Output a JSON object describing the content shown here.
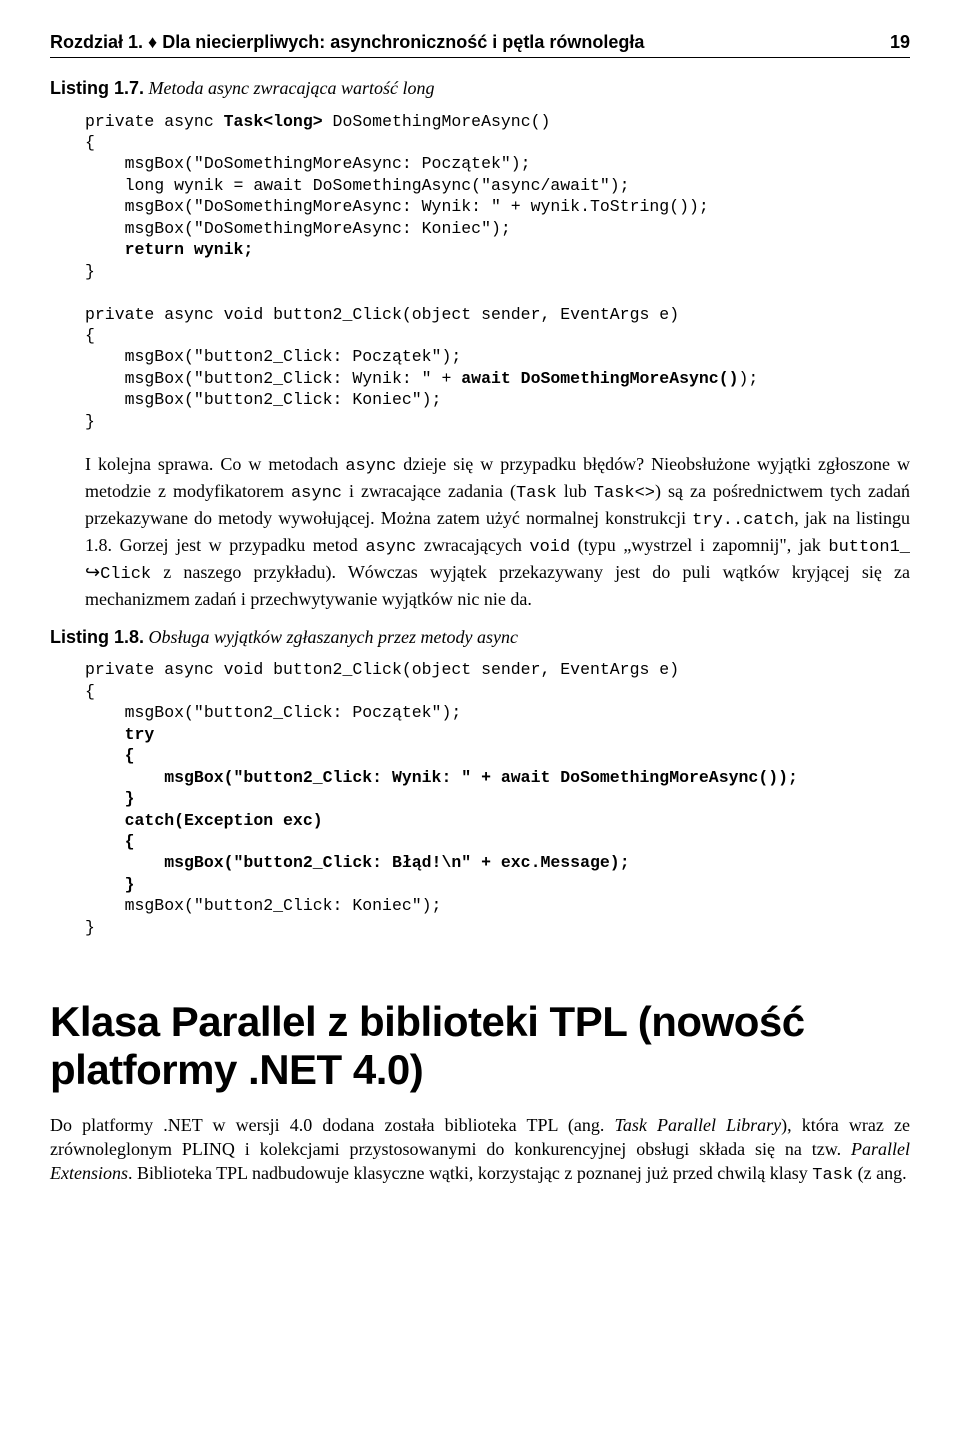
{
  "header": {
    "chapter": "Rozdział 1. ♦ Dla niecierpliwych: asynchroniczność i pętla równoległa",
    "page": "19"
  },
  "listing17": {
    "label": "Listing 1.7.",
    "title": "Metoda async zwracająca wartość long"
  },
  "code17": {
    "l1a": "private async ",
    "l1b": "Task<long>",
    "l1c": " DoSomethingMoreAsync()",
    "l2": "{",
    "l3": "    msgBox(\"DoSomethingMoreAsync: Początek\");",
    "l4": "    long wynik = await DoSomethingAsync(\"async/await\");",
    "l5": "    msgBox(\"DoSomethingMoreAsync: Wynik: \" + wynik.ToString());",
    "l6": "    msgBox(\"DoSomethingMoreAsync: Koniec\");",
    "l7a": "    ",
    "l7b": "return wynik;",
    "l8": "}",
    "l9": "",
    "l10": "private async void button2_Click(object sender, EventArgs e)",
    "l11": "{",
    "l12": "    msgBox(\"button2_Click: Początek\");",
    "l13a": "    msgBox(\"button2_Click: Wynik: \" + ",
    "l13b": "await DoSomethingMoreAsync()",
    "l13c": ");",
    "l14": "    msgBox(\"button2_Click: Koniec\");",
    "l15": "}"
  },
  "para1": {
    "t1": "I kolejna sprawa. Co w metodach ",
    "c1": "async",
    "t2": " dzieje się w przypadku błędów? Nieobsłużone wyjątki zgłoszone w metodzie z modyfikatorem ",
    "c2": "async",
    "t3": " i zwracające zadania (",
    "c3": "Task",
    "t4": " lub ",
    "c4": "Task<>",
    "t5": ") są za pośrednictwem tych zadań przekazywane do metody wywołującej. Można zatem użyć normalnej konstrukcji ",
    "c5": "try..catch",
    "t6": ", jak na listingu 1.8. Gorzej jest w przypadku metod ",
    "c6": "async",
    "t7": " zwracających ",
    "c7": "void",
    "t8": " (typu „wystrzel i zapomnij\", jak ",
    "c8": "button1_",
    "c8b": "Click",
    "t9": " z naszego przykładu). Wówczas wyjątek przekazywany jest do puli wątków kryjącej się za mechanizmem zadań i przechwytywanie wyjątków nic nie da."
  },
  "listing18": {
    "label": "Listing 1.8.",
    "title": "Obsługa wyjątków zgłaszanych przez metody async"
  },
  "code18": {
    "l1": "private async void button2_Click(object sender, EventArgs e)",
    "l2": "{",
    "l3": "    msgBox(\"button2_Click: Początek\");",
    "l4a": "    ",
    "l4b": "try",
    "l5a": "    ",
    "l5b": "{",
    "l6a": "        ",
    "l6b": "msgBox(\"button2_Click: Wynik: \" + await DoSomethingMoreAsync());",
    "l7a": "    ",
    "l7b": "}",
    "l8a": "    ",
    "l8b": "catch(Exception exc)",
    "l9a": "    ",
    "l9b": "{",
    "l10a": "        ",
    "l10b": "msgBox(\"button2_Click: Błąd!\\n\" + exc.Message);",
    "l11a": "    ",
    "l11b": "}",
    "l12": "    msgBox(\"button2_Click: Koniec\");",
    "l13": "}"
  },
  "section": {
    "title": "Klasa Parallel z biblioteki TPL (nowość platformy .NET 4.0)"
  },
  "para2": {
    "t1": "Do platformy .NET w wersji 4.0 dodana została biblioteka TPL (ang. ",
    "i1": "Task Parallel Library",
    "t2": "), która wraz ze zrównoleglonym PLINQ i kolekcjami przystosowanymi do konkurencyjnej obsługi składa się na tzw. ",
    "i2": "Parallel Extensions",
    "t3": ". Biblioteka TPL nadbudowuje klasyczne wątki, korzystając z poznanej już przed chwilą klasy ",
    "c1": "Task",
    "t4": " (z ang."
  }
}
